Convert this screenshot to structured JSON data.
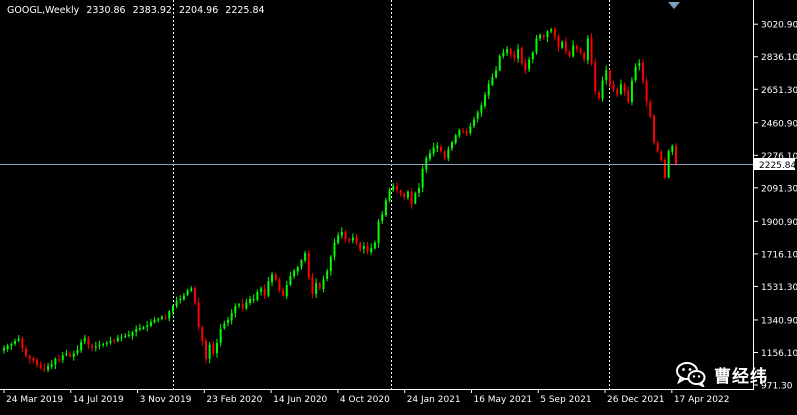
{
  "window": {
    "symbol": "GOOGL,Weekly",
    "ohlc": [
      "2330.86",
      "2383.92",
      "2204.96",
      "2225.84"
    ],
    "current_price_label": "2225.84"
  },
  "watermark": {
    "text": "曹经纬",
    "icon": "wechat-icon"
  },
  "colors": {
    "background": "#000000",
    "bull": "#00ff00",
    "bear": "#ff0000",
    "grid": "#ffffff",
    "axis_text": "#ffffff",
    "price_line": "#8fa3b8"
  },
  "chart_data": {
    "type": "candlestick",
    "title": "GOOGL,Weekly",
    "ylim": [
      971.3,
      3113
    ],
    "y_ticks": [
      "3020.90",
      "2836.10",
      "2651.30",
      "2460.90",
      "2276.10",
      "2091.30",
      "1900.90",
      "1716.10",
      "1531.30",
      "1340.90",
      "1156.10",
      "971.30"
    ],
    "x_ticks": [
      "24 Mar 2019",
      "14 Jul 2019",
      "3 Nov 2019",
      "23 Feb 2020",
      "14 Jun 2020",
      "4 Oct 2020",
      "24 Jan 2021",
      "16 May 2021",
      "5 Sep 2021",
      "26 Dec 2021",
      "17 Apr 2022"
    ],
    "x_start": "24 Mar 2019",
    "x_end": "24 Apr 2022",
    "period_separators": [
      "1 Jan 2020",
      "1 Jan 2021",
      "1 Jan 2022"
    ],
    "current_price": 2225.84,
    "grid": false,
    "weekly_closes": [
      1180,
      1195,
      1205,
      1220,
      1235,
      1180,
      1140,
      1120,
      1110,
      1085,
      1070,
      1060,
      1080,
      1090,
      1120,
      1115,
      1140,
      1150,
      1135,
      1150,
      1170,
      1215,
      1240,
      1200,
      1185,
      1190,
      1200,
      1205,
      1210,
      1222,
      1220,
      1240,
      1245,
      1250,
      1255,
      1270,
      1290,
      1295,
      1300,
      1310,
      1330,
      1340,
      1345,
      1360,
      1350,
      1390,
      1420,
      1450,
      1460,
      1480,
      1510,
      1520,
      1440,
      1300,
      1220,
      1120,
      1200,
      1150,
      1210,
      1290,
      1320,
      1340,
      1380,
      1420,
      1430,
      1410,
      1440,
      1460,
      1460,
      1500,
      1520,
      1480,
      1560,
      1600,
      1570,
      1510,
      1480,
      1540,
      1590,
      1620,
      1640,
      1680,
      1720,
      1580,
      1490,
      1550,
      1520,
      1570,
      1620,
      1700,
      1780,
      1820,
      1840,
      1800,
      1790,
      1810,
      1780,
      1740,
      1760,
      1730,
      1750,
      1780,
      1900,
      1940,
      2020,
      2080,
      2100,
      2080,
      2060,
      2040,
      2070,
      2000,
      2060,
      2090,
      2200,
      2260,
      2290,
      2320,
      2330,
      2300,
      2260,
      2310,
      2350,
      2390,
      2420,
      2410,
      2400,
      2440,
      2480,
      2520,
      2560,
      2620,
      2680,
      2720,
      2760,
      2840,
      2860,
      2880,
      2850,
      2830,
      2880,
      2800,
      2760,
      2820,
      2860,
      2940,
      2960,
      2950,
      2980,
      2990,
      2950,
      2890,
      2920,
      2870,
      2840,
      2900,
      2880,
      2860,
      2820,
      2940,
      2800,
      2640,
      2600,
      2700,
      2760,
      2680,
      2650,
      2620,
      2680,
      2640,
      2580,
      2700,
      2780,
      2800,
      2700,
      2580,
      2500,
      2350,
      2300,
      2250,
      2150,
      2300,
      2330,
      2225.84
    ]
  }
}
